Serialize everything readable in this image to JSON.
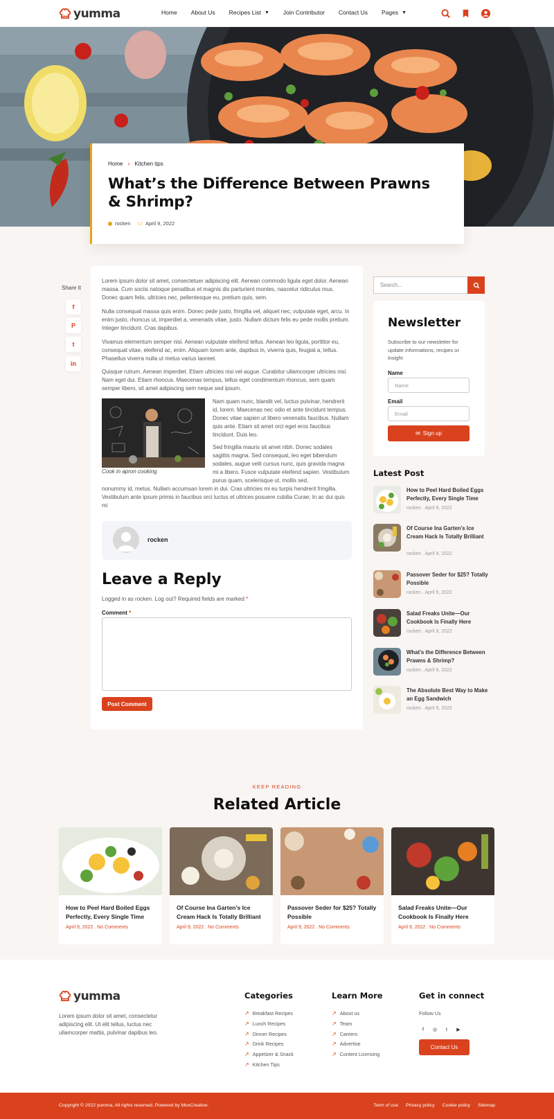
{
  "colors": {
    "accent": "#d9421d",
    "gold": "#e8a317"
  },
  "header": {
    "logo_text": "yumma",
    "nav": [
      {
        "label": "Home"
      },
      {
        "label": "About Us"
      },
      {
        "label": "Recipes List",
        "dropdown": true
      },
      {
        "label": "Join Contributor"
      },
      {
        "label": "Contact Us"
      },
      {
        "label": "Pages",
        "dropdown": true
      }
    ],
    "icons": [
      "search-icon",
      "bookmark-icon",
      "user-icon"
    ]
  },
  "post": {
    "breadcrumb": {
      "home": "Home",
      "current": "Kitchen tips"
    },
    "title": "What’s the Difference Between Prawns & Shrimp?",
    "author": "rocken",
    "date": "April 9, 2022"
  },
  "share": {
    "label": "Share It",
    "icons": [
      "facebook-icon",
      "pinterest-icon",
      "twitter-icon",
      "linkedin-icon"
    ]
  },
  "article": {
    "p1": "Lorem ipsum dolor sit amet, consectetuer adipiscing elit. Aenean commodo ligula eget dolor. Aenean massa. Cum sociis natoque penatibus et magnis dis parturient montes, nascetur ridiculus mus. Donec quam felis, ultricies nec, pellentesque eu, pretium quis, sem.",
    "p2": "Nulla consequat massa quis enim. Donec pede justo, fringilla vel, aliquet nec, vulputate eget, arcu. In enim justo, rhoncus ut, imperdiet a, venenatis vitae, justo. Nullam dictum felis eu pede mollis pretium. Integer tincidunt. Cras dapibus.",
    "p3": "Vivamus elementum semper nisi. Aenean vulputate eleifend tellus. Aenean leo ligula, porttitor eu, consequat vitae, eleifend ac, enim. Aliquam lorem ante, dapibus in, viverra quis, feugiat a, tellus. Phasellus viverra nulla ut metus varius laoreet.",
    "p4": "Quisque rutrum. Aenean imperdiet. Etiam ultricies nisi vel augue. Curabitur ullamcorper ultricies nisi. Nam eget dui. Etiam rhoncus. Maecenas tempus, tellus eget condimentum rhoncus, sem quam semper libero, sit amet adipiscing sem neque sed ipsum.",
    "figure_caption": "Cook in apron cooking",
    "p5": "Nam quam nunc, blandit vel, luctus pulvinar, hendrerit id, lorem. Maecenas nec odio et ante tincidunt tempus. Donec vitae sapien ut libero venenatis faucibus. Nullam quis ante. Etiam sit amet orci eget eros faucibus tincidunt. Duis leo.",
    "p6_side": "Sed fringilla mauris sit amet nibh. Donec sodales sagittis magna. Sed consequat, leo eget bibendum sodales, augue velit cursus nunc, quis gravida magna mi a libero. Fusce vulputate eleifend sapien. Vestibulum purus quam, scelerisque ut, mollis sed,",
    "p6_full": "nonummy id, metus. Nullam accumsan lorem in dui. Cras ultricies mi eu turpis hendrerit fringilla. Vestibulum ante ipsum primis in faucibus orci luctus et ultrices posuere cubilia Curae; In ac dui quis mi",
    "author_name": "rocken"
  },
  "reply": {
    "title": "Leave a Reply",
    "note": "Logged in as rocken. Log out? Required fields are marked",
    "req_mark": "*",
    "comment_label": "Comment",
    "submit": "Post Comment"
  },
  "sidebar": {
    "search_placeholder": "Search...",
    "newsletter": {
      "title": "Newsletter",
      "desc": "Subscribe to our newsletter for update informations, recipes or insight",
      "name_label": "Name",
      "name_placeholder": "Name",
      "email_label": "Email",
      "email_placeholder": "Email",
      "button": "Sign up"
    },
    "latest_title": "Latest Post",
    "latest": [
      {
        "title": "How to Peel Hard Boiled Eggs Perfectly, Every Single Time",
        "meta": "rocken . April 9, 2022"
      },
      {
        "title": "Of Course Ina Garten’s Ice Cream Hack Is Totally Brilliant",
        "meta": "rocken . April 9, 2022"
      },
      {
        "title": "Passover Seder for $25? Totally Possible",
        "meta": "rocken . April 9, 2022"
      },
      {
        "title": "Salad Freaks Unite—Our Cookbook Is Finally Here",
        "meta": "rocken . April 9, 2022"
      },
      {
        "title": "What’s the Difference Between Prawns & Shrimp?",
        "meta": "rocken . April 9, 2022"
      },
      {
        "title": "The Absolute Best Way to Make an Egg Sandwich",
        "meta": "rocken . April 9, 2022"
      }
    ]
  },
  "related": {
    "kicker": "KEEP READING",
    "title": "Related Article",
    "cards": [
      {
        "title": "How to Peel Hard Boiled Eggs Perfectly, Every Single Time",
        "meta": "April 9, 2022 . No Comments"
      },
      {
        "title": "Of Course Ina Garten’s Ice Cream Hack Is Totally Brilliant",
        "meta": "April 9, 2022 . No Comments"
      },
      {
        "title": "Passover Seder for $25? Totally Possible",
        "meta": "April 9, 2022 . No Comments"
      },
      {
        "title": "Salad Freaks Unite—Our Cookbook Is Finally Here",
        "meta": "April 9, 2022 . No Comments"
      }
    ]
  },
  "footer": {
    "logo_text": "yumma",
    "about": "Lorem ipsum dolor sit amet, consectetur adipiscing elit. Ut elit tellus, luctus nec ullamcorper mattis, pulvinar dapibus leo.",
    "categories_title": "Categories",
    "categories": [
      "Breakfast Recipes",
      "Lunch Recipes",
      "Dinner Recipes",
      "Drink Recipes",
      "Appetizer & Snack",
      "Kitchen Tips"
    ],
    "learn_title": "Learn More",
    "learn": [
      "About us",
      "Team",
      "Careers",
      "Advertise",
      "Content Licensing"
    ],
    "connect_title": "Get in connect",
    "follow": "Follow Us",
    "social_icons": [
      "facebook-icon",
      "instagram-icon",
      "twitter-icon",
      "youtube-icon"
    ],
    "contact_button": "Contact Us",
    "copyright": "Copyright © 2022 yumma, All rights reserved. Powered by MoxCreative.",
    "bottom_links": [
      "Term of use",
      "Privacy policy",
      "Cookie policy",
      "Sitemap"
    ]
  }
}
